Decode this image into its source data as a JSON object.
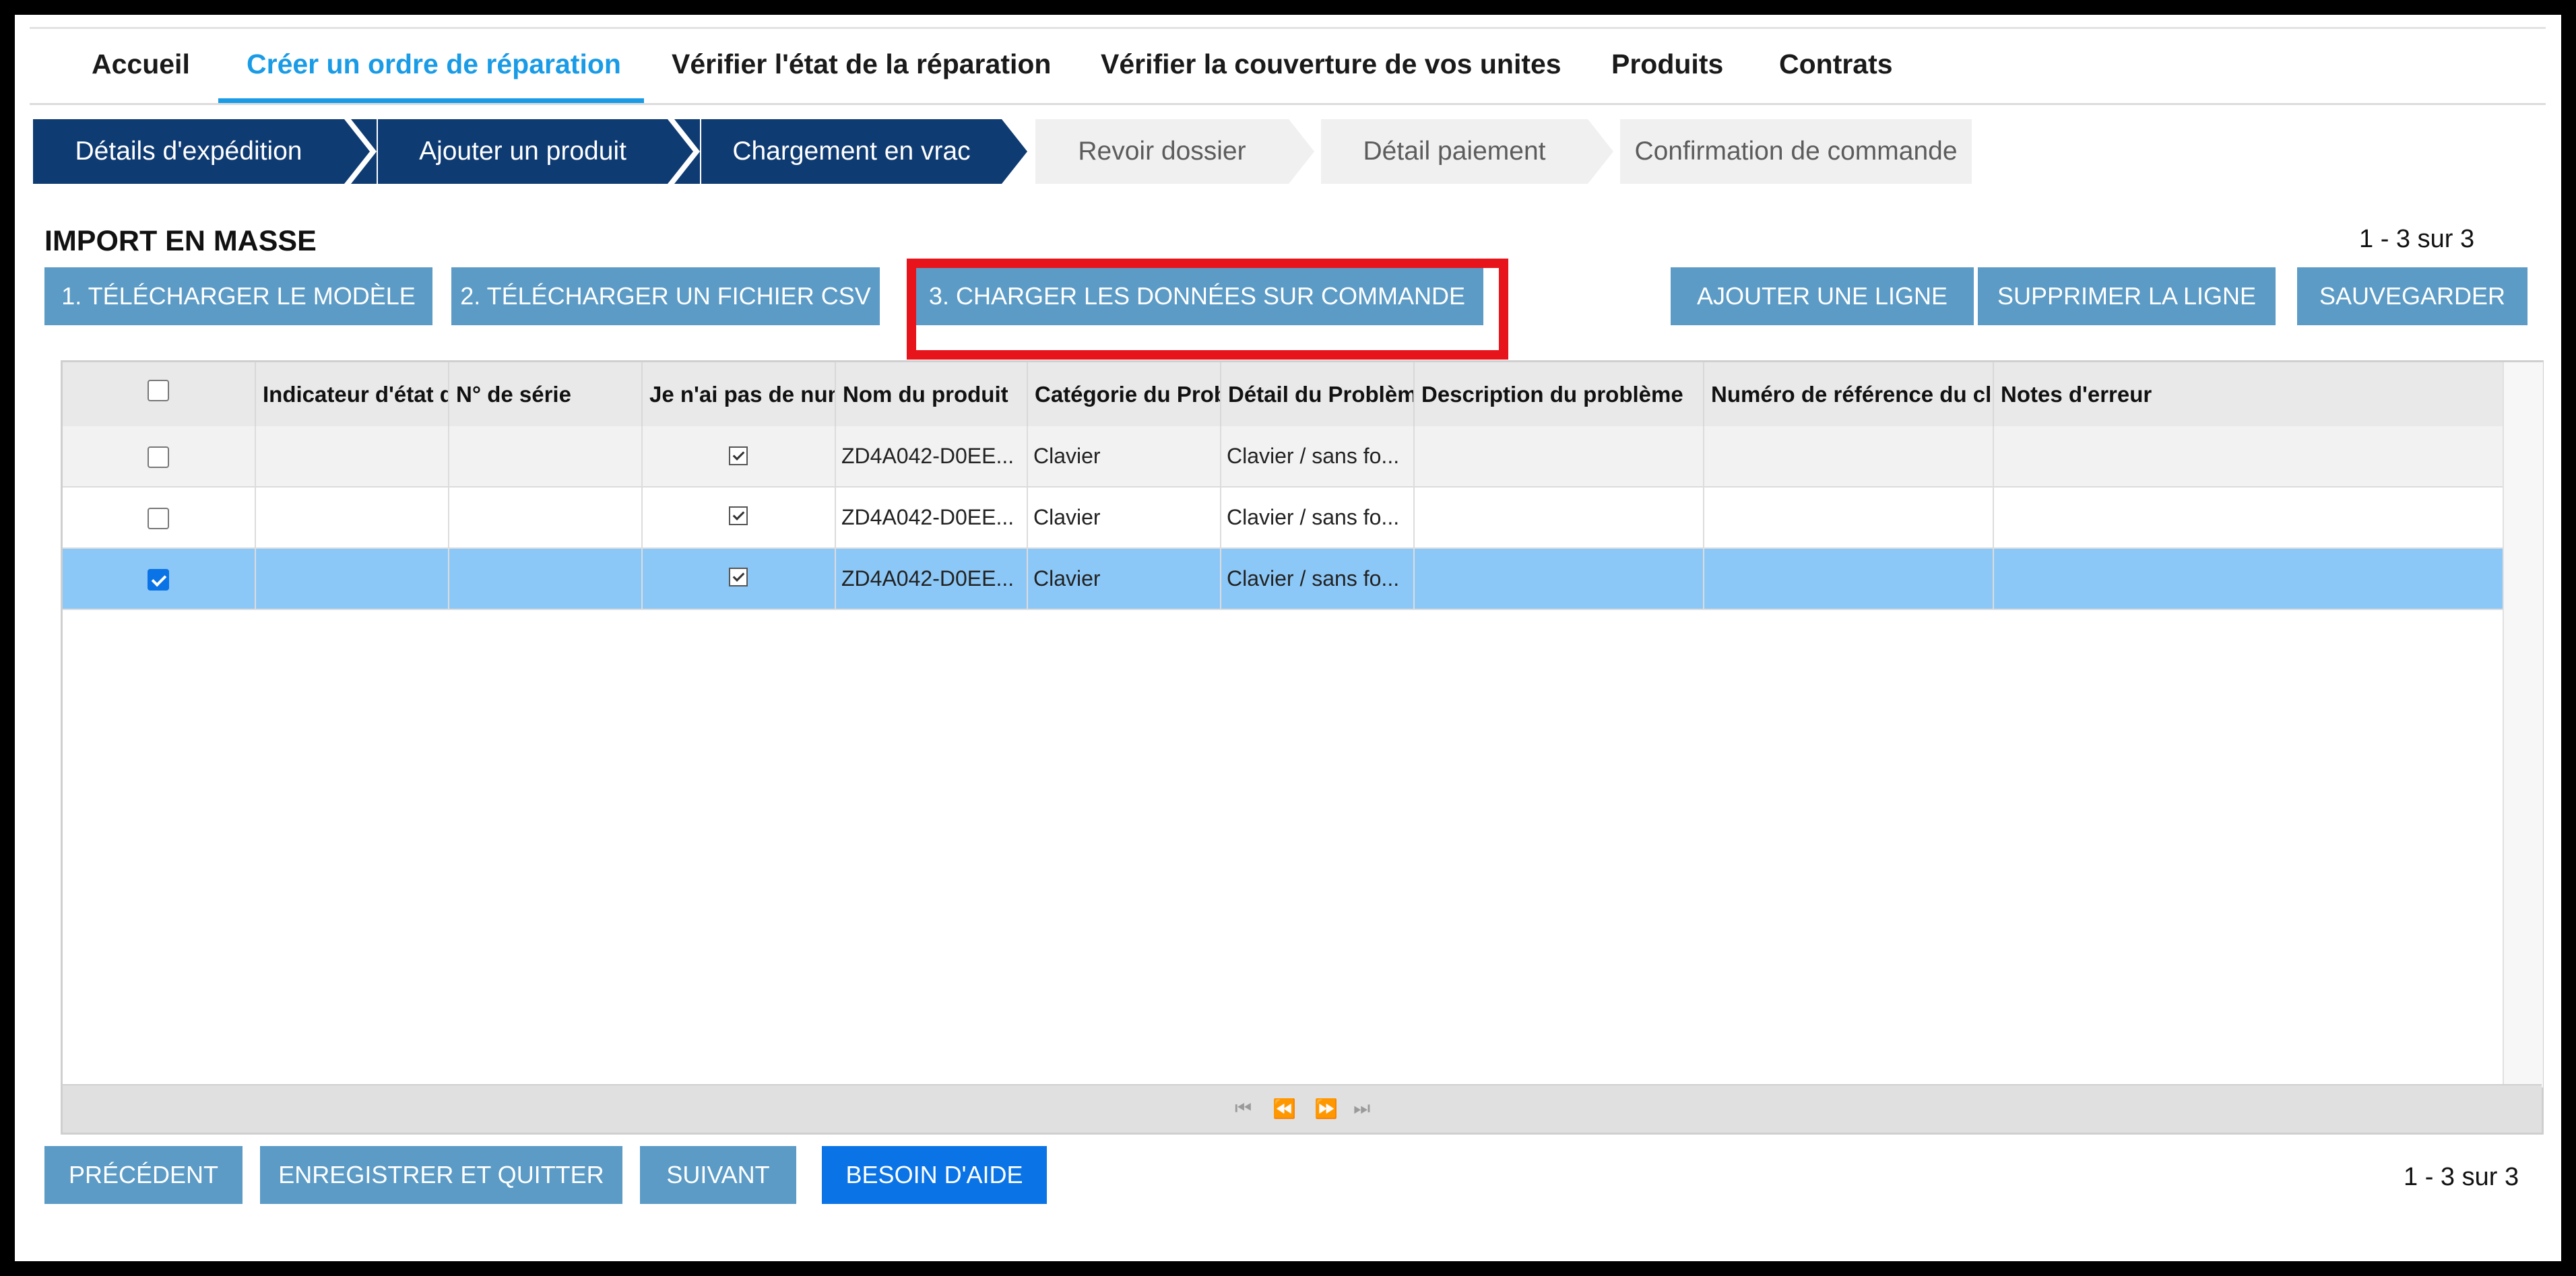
{
  "nav": {
    "items": [
      {
        "label": "Accueil"
      },
      {
        "label": "Créer un ordre de réparation"
      },
      {
        "label": "Vérifier l'état de la réparation"
      },
      {
        "label": "Vérifier la couverture de vos unites"
      },
      {
        "label": "Produits"
      },
      {
        "label": "Contrats"
      }
    ],
    "active": "Créer un ordre de réparation"
  },
  "wizard": {
    "steps": [
      {
        "label": "Détails d'expédition",
        "state": "done"
      },
      {
        "label": "Ajouter un produit",
        "state": "done"
      },
      {
        "label": "Chargement en vrac",
        "state": "current"
      },
      {
        "label": "Revoir dossier",
        "state": "todo"
      },
      {
        "label": "Détail paiement",
        "state": "todo"
      },
      {
        "label": "Confirmation de commande",
        "state": "todo"
      }
    ]
  },
  "section": {
    "title": "IMPORT EN MASSE",
    "count_top": "1 - 3 sur 3",
    "count_bottom": "1 - 3 sur 3"
  },
  "toolbar": {
    "download_template": "1. TÉLÉCHARGER LE MODÈLE",
    "upload_csv": "2. TÉLÉCHARGER UN FICHIER CSV",
    "load_data": "3. CHARGER LES DONNÉES SUR COMMANDE",
    "add_row": "AJOUTER UNE LIGNE",
    "delete_row": "SUPPRIMER LA LIGNE",
    "save": "SAUVEGARDER"
  },
  "grid": {
    "columns": [
      "Indicateur d'état de",
      "N° de série",
      "Je n'ai pas de num",
      "Nom du produit",
      "Catégorie du Prob",
      "Détail du Problème",
      "Description du problème",
      "Numéro de référence du clie",
      "Notes d'erreur"
    ],
    "rows": [
      {
        "selected": false,
        "status": "",
        "serial": "",
        "no_serial": true,
        "product": "ZD4A042-D0EE...",
        "category": "Clavier",
        "detail": "Clavier / sans fo...",
        "description": "",
        "reference": "",
        "notes": ""
      },
      {
        "selected": false,
        "status": "",
        "serial": "",
        "no_serial": true,
        "product": "ZD4A042-D0EE...",
        "category": "Clavier",
        "detail": "Clavier / sans fo...",
        "description": "",
        "reference": "",
        "notes": ""
      },
      {
        "selected": true,
        "status": "",
        "serial": "",
        "no_serial": true,
        "product": "ZD4A042-D0EE...",
        "category": "Clavier",
        "detail": "Clavier / sans fo...",
        "description": "",
        "reference": "",
        "notes": ""
      }
    ],
    "pager_icons": [
      "first-page-icon",
      "prev-page-icon",
      "next-page-icon",
      "last-page-icon"
    ]
  },
  "footer": {
    "previous": "PRÉCÉDENT",
    "save_quit": "ENREGISTRER ET QUITTER",
    "next": "SUIVANT",
    "help": "BESOIN D'AIDE"
  },
  "colors": {
    "accent": "#1a9be6",
    "wizard_done": "#0f3b73",
    "button": "#5b9bc6",
    "button_primary": "#0a73e6",
    "highlight": "#e8141b",
    "selected_row": "#8cc8f7"
  }
}
